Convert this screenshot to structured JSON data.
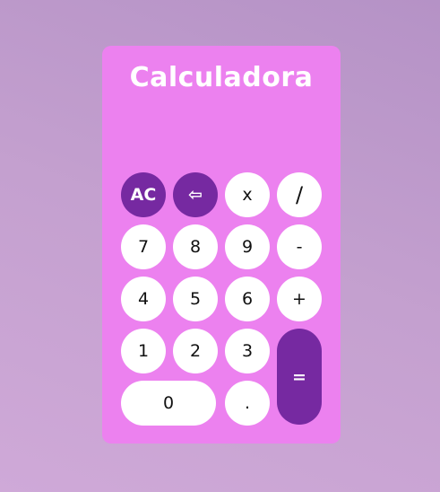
{
  "app": {
    "title": "Calculadora",
    "display_value": ""
  },
  "colors": {
    "panel": "#ec81ef",
    "accent": "#7629a1",
    "key": "#ffffff"
  },
  "keys": {
    "clear": "AC",
    "backspace": "⇦",
    "multiply": "x",
    "divide": "/",
    "seven": "7",
    "eight": "8",
    "nine": "9",
    "minus": "-",
    "four": "4",
    "five": "5",
    "six": "6",
    "plus": "+",
    "one": "1",
    "two": "2",
    "three": "3",
    "equals": "=",
    "zero": "0",
    "decimal": "."
  }
}
